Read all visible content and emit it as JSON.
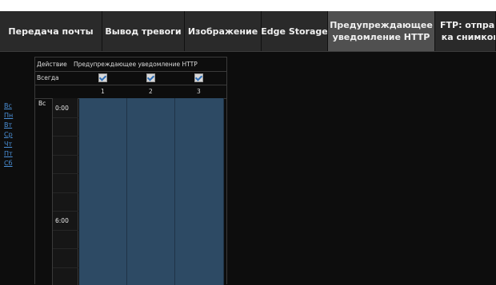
{
  "tabs": [
    {
      "label": "Передача почты"
    },
    {
      "label": "Вывод тревоги"
    },
    {
      "label": "Изображение"
    },
    {
      "label": "Edge Storage"
    },
    {
      "label": "Предупреждающее уведомление HTTP",
      "line1": "Предупреждающее",
      "line2": "уведомление HTTP",
      "active": true
    },
    {
      "label": "FTP: отправка снимков",
      "line1": "FTP: отправ",
      "line2": "ка снимков"
    }
  ],
  "days": [
    "Вс",
    "Пн",
    "Вт",
    "Ср",
    "Чт",
    "Пт",
    "Сб"
  ],
  "table": {
    "action_label": "Действие",
    "notification_header": "Предупреждающее уведомление HTTP",
    "always_label": "Всегда",
    "checks": [
      true,
      true,
      true
    ],
    "columns": [
      "1",
      "2",
      "3"
    ]
  },
  "schedule": {
    "day": "Вс",
    "times": [
      "0:00",
      "6:00"
    ]
  },
  "colors": {
    "background": "#0d0d0d",
    "tab_bar": "#2a2a2a",
    "tab_active": "#505050",
    "link": "#4a8fd6",
    "slot_fill": "#2d4a64"
  }
}
